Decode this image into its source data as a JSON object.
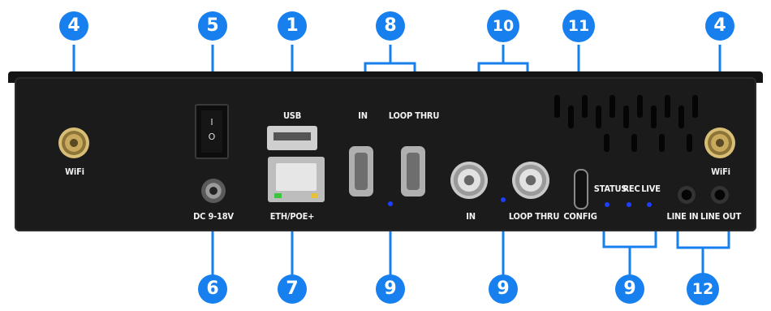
{
  "labels": {
    "wifi": "WiFi",
    "usb": "USB",
    "dc": "DC 9-18V",
    "eth": "ETH/POE+",
    "hdmi_in": "IN",
    "hdmi_loop": "LOOP THRU",
    "sdi_in": "IN",
    "sdi_loop": "LOOP THRU",
    "config": "CONFIG",
    "status": "STATUS",
    "rec": "REC",
    "live": "LIVE",
    "line_in": "LINE IN",
    "line_out": "LINE OUT"
  },
  "switch": {
    "on": "I",
    "off": "O"
  },
  "callouts": {
    "wifi_left": "4",
    "power": "5",
    "usb": "1",
    "hdmi": "8",
    "sdi": "10",
    "usbc": "11",
    "wifi_right": "4",
    "dc": "6",
    "eth": "7",
    "led_hdmi": "9",
    "led_sdi": "9",
    "led_status": "9",
    "audio": "12"
  },
  "colors": {
    "callout": "#1780ee",
    "device": "#1b1b1b",
    "led": "#1d3fff",
    "eth_led_left": "#3cc43c",
    "eth_led_right": "#e6c23a"
  }
}
